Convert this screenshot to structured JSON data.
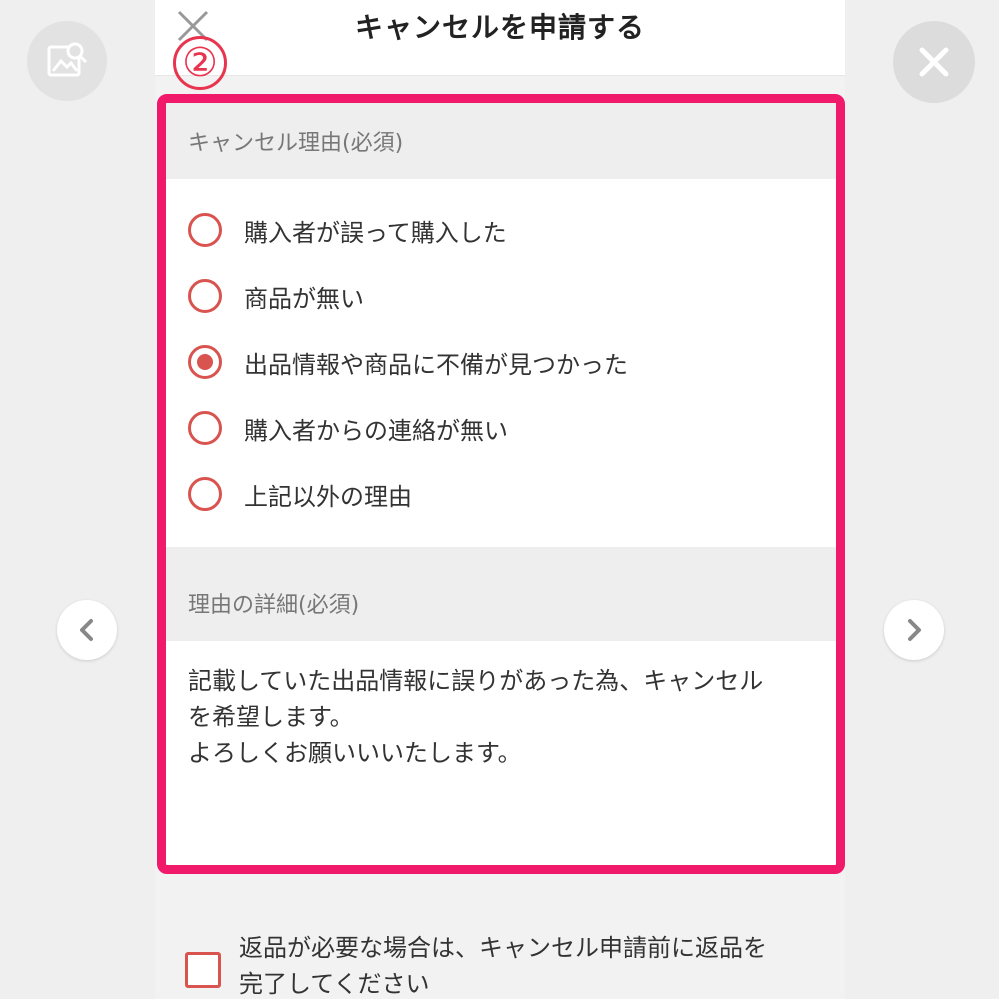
{
  "viewer": {
    "image_search_icon": "image-search-icon",
    "close_icon": "close-icon",
    "prev_icon": "chevron-left-icon",
    "next_icon": "chevron-right-icon"
  },
  "header": {
    "title": "キャンセルを申請する",
    "annotation": "②"
  },
  "cancel_reason": {
    "label": "キャンセル理由(必須)",
    "options": [
      {
        "label": "購入者が誤って購入した",
        "checked": false
      },
      {
        "label": "商品が無い",
        "checked": false
      },
      {
        "label": "出品情報や商品に不備が見つかった",
        "checked": true
      },
      {
        "label": "購入者からの連絡が無い",
        "checked": false
      },
      {
        "label": "上記以外の理由",
        "checked": false
      }
    ]
  },
  "reason_detail": {
    "label": "理由の詳細(必須)",
    "text": "記載していた出品情報に誤りがあった為、キャンセル\nを希望します。\nよろしくお願いいいたします。"
  },
  "return_check": {
    "label": "返品が必要な場合は、キャンセル申請前に返品を\n完了してください",
    "checked": false
  },
  "colors": {
    "highlight": "#f0196a",
    "accent": "#d9534f",
    "annotation": "#e8344e"
  }
}
